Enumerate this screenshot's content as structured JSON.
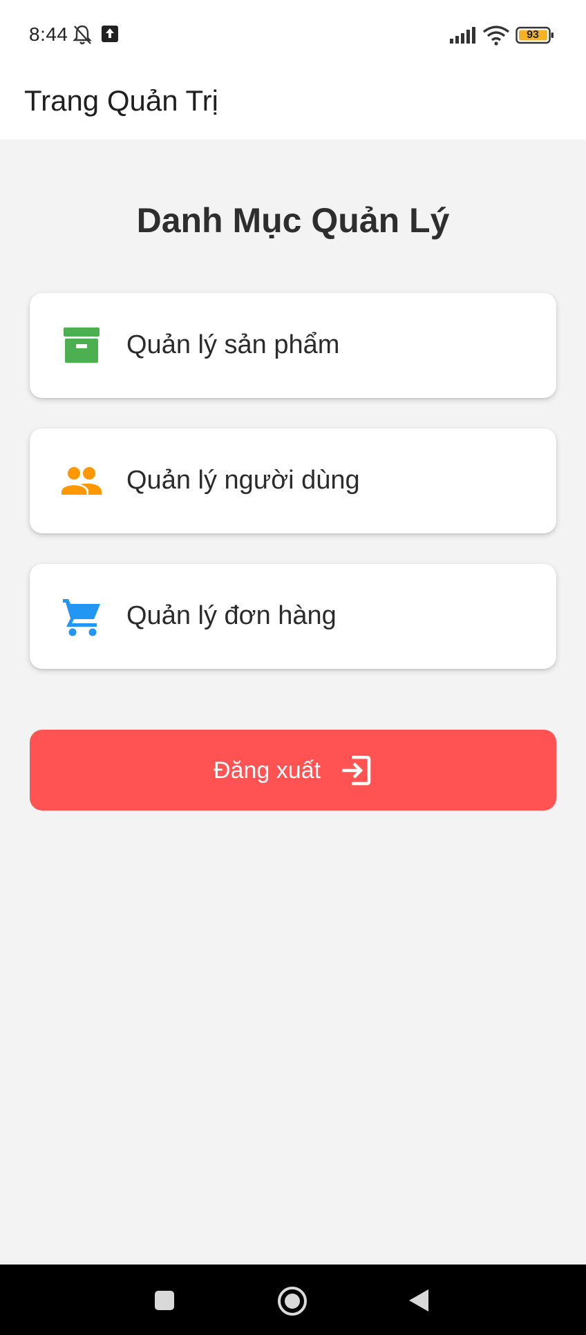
{
  "status_bar": {
    "time": "8:44",
    "battery": "93",
    "icons": [
      "bell-off-icon",
      "upload-icon",
      "signal-icon",
      "wifi-icon",
      "battery-icon"
    ]
  },
  "app_bar": {
    "title": "Trang Quản Trị"
  },
  "main": {
    "section_title": "Danh Mục Quản Lý",
    "menu_items": [
      {
        "label": "Quản lý sản phẩm",
        "icon": "archive-box-icon",
        "color": "#4caf50"
      },
      {
        "label": "Quản lý người dùng",
        "icon": "people-icon",
        "color": "#ff9800"
      },
      {
        "label": "Quản lý đơn hàng",
        "icon": "shopping-cart-icon",
        "color": "#2196f3"
      }
    ],
    "logout": {
      "label": "Đăng xuất",
      "icon": "logout-icon",
      "color": "#ff5252"
    }
  },
  "nav_bar": {
    "icons": [
      "recents-icon",
      "home-icon",
      "back-icon"
    ]
  }
}
